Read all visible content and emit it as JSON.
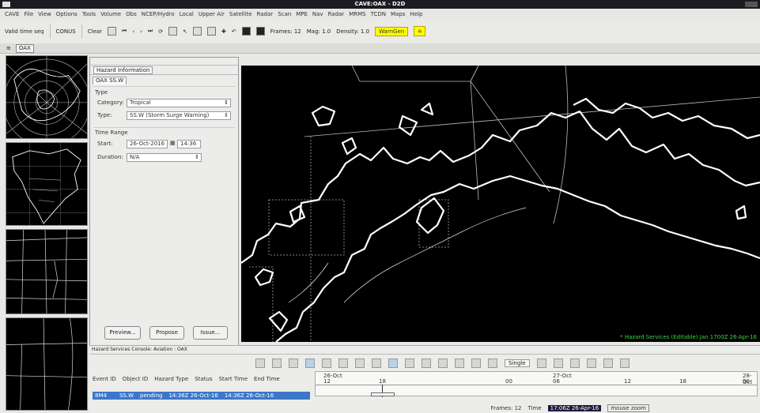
{
  "window": {
    "title": "CAVE:OAX - D2D"
  },
  "menubar": {
    "items": [
      "CAVE",
      "File",
      "View",
      "Options",
      "Tools",
      "Volume",
      "Obs",
      "NCEP/Hydro",
      "Local",
      "Upper Air",
      "Satellite",
      "Radar",
      "Scan",
      "MPE",
      "Nav",
      "Radar",
      "MRMS",
      "TCDN",
      "Maps",
      "Help"
    ]
  },
  "toolbar": {
    "load_mode": "Valid time seq",
    "scale": "CONUS",
    "clear": "Clear",
    "frames_label": "Frames: 12",
    "mag_label": "Mag: 1.0",
    "density_label": "Density: 1.0",
    "warngen": "WarnGen"
  },
  "tabs": {
    "main": "OAX"
  },
  "hazard": {
    "header": "",
    "title": "Hazard Information",
    "tab": "OAX SS.W",
    "type_label": "Type",
    "category_label": "Category:",
    "category_value": "Tropical",
    "type_field_label": "Type:",
    "type_value": "SS.W (Storm Surge Warning)",
    "time_range_label": "Time Range",
    "start_label": "Start:",
    "start_date": "26-Oct-2016",
    "start_time": "14:36",
    "duration_label": "Duration:",
    "duration_value": "N/A",
    "buttons": {
      "preview": "Preview...",
      "propose": "Propose",
      "issue": "Issue..."
    }
  },
  "map": {
    "legend": "* Hazard Services (Editable)   Jan 1700Z 26-Apr-16"
  },
  "console": {
    "title": "Hazard Services Console: Aviation : OAX",
    "single_label": "Single",
    "columns": [
      "Event ID",
      "Object ID",
      "Hazard Type",
      "Status",
      "Start Time",
      "End Time"
    ],
    "row": [
      "8M4",
      "",
      "SS.W",
      "pending",
      "14:36Z 26-Oct-16",
      "14:36Z 26-Oct-16"
    ],
    "timeline": {
      "days": [
        "26-Oct",
        "27-Oct",
        "28-Oct"
      ],
      "hours": [
        "12",
        "18",
        "00",
        "06",
        "12",
        "18",
        "00"
      ]
    }
  },
  "status": {
    "frames": "Frames: 12",
    "time_label": "Time",
    "time_value": "17:06Z 26-Apr-16",
    "zoom": "mouse zoom"
  }
}
